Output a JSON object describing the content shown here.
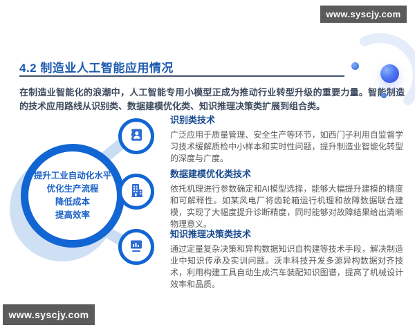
{
  "watermarks": {
    "top": "www.syscjy.com",
    "bottom": "www.syscjy.com"
  },
  "header": {
    "title": "4.2 制造业人工智能应用情况"
  },
  "intro": {
    "text": "在制造业智能化的浪潮中，人工智能专用小模型正成为推动行业转型升级的重要力量。智能制造的技术应用路线从识别类、数据建模优化类、知识推理决策类扩展到组合类。"
  },
  "diagram": {
    "center_lines": [
      "提升工业自动化水平",
      "优化生产流程",
      "降低成本",
      "提高效率"
    ],
    "icons": [
      "id-card-icon",
      "building-icon",
      "chart-board-icon"
    ]
  },
  "sections": [
    {
      "title": "识别类技术",
      "body": "广泛应用于质量管理、安全生产等环节，如西门子利用自监督学习技术缓解质检中小样本和实时性问题，提升制造业智能化转型的深度与广度。"
    },
    {
      "title": "数据建模优化类技术",
      "body": "依托机理进行参数确定和AI模型选择，能够大幅提升建模的精度和可解释性。如某风电厂将齿轮箱运行机理和故障数据联合建模，实现了大幅度提升诊断精度，同时能够对故障结果给出清晰物理意义。"
    },
    {
      "title": "知识推理决策类技术",
      "body": "通过定量复杂决策和异构数据知识自构建等技术手段，解决制造业中知识传承及实训问题。沃丰科技开发多源异构数据对齐技术，利用构建工具自动生成汽车装配知识图谱，提高了机械设计效率和品质。"
    }
  ],
  "colors": {
    "accent_blue": "#1266d3",
    "title_blue": "#1c5ab0",
    "heading_blue": "#17498f",
    "body_gray": "#5a5a5a",
    "connector_blue": "#cbddf4",
    "badge_gray": "#5b5b5b",
    "underline_slate": "#44546a"
  }
}
